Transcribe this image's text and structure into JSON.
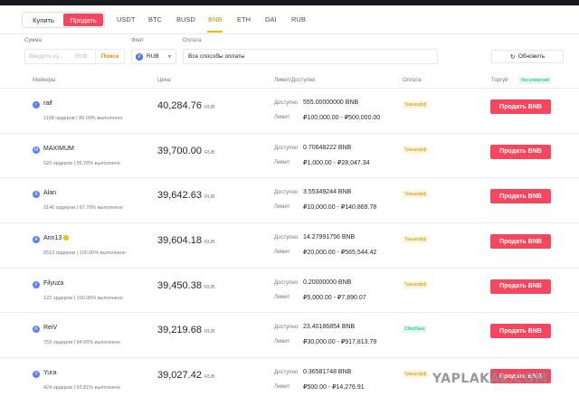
{
  "trade_toggle": {
    "buy": "Купить",
    "sell": "Продать"
  },
  "assets": [
    "USDT",
    "BTC",
    "BUSD",
    "BNB",
    "ETH",
    "DAI",
    "RUB"
  ],
  "active_asset": "BNB",
  "filters": {
    "amount_label": "Сумма",
    "amount_placeholder": "Введите су...",
    "amount_currency": "RUB",
    "search_label": "Поиск",
    "fiat_label": "Фиат",
    "fiat_value": "RUB",
    "payment_label": "Оплата",
    "payment_value": "Все способы оплаты",
    "refresh_label": "Обновить"
  },
  "table_headers": {
    "makers": "Мейкеры",
    "price": "Цена",
    "limit": "Лимит/Доступно",
    "payment": "Оплата",
    "trade": "Торгуй",
    "no_fee": "без комиссий"
  },
  "labels": {
    "available": "Доступно",
    "limit": "Лимит",
    "sell_button": "Продать BNB",
    "price_currency": "RUB"
  },
  "offers": [
    {
      "initial": "r",
      "name": "raif",
      "verified": false,
      "stats": "1108 ордеров | 86.09% выполнено",
      "price": "40,284.76",
      "available": "555.00000000 BNB",
      "limit": "₽100,000.00 - ₽500,000.00",
      "payment": "Тинькофф",
      "payment_type": "tinkoff"
    },
    {
      "initial": "M",
      "name": "MAXIMUM",
      "verified": false,
      "stats": "520 ордеров | 95.76% выполнено",
      "price": "39,700.00",
      "available": "0.70648222 BNB",
      "limit": "₽1,000.00 - ₽28,047.34",
      "payment": "Тинькофф",
      "payment_type": "tinkoff"
    },
    {
      "initial": "A",
      "name": "Alan",
      "verified": false,
      "stats": "3146 ордеров | 97.70% выполнено",
      "price": "39,642.63",
      "available": "3.55349244 BNB",
      "limit": "₽10,000.00 - ₽140,869.78",
      "payment": "Тинькофф",
      "payment_type": "tinkoff"
    },
    {
      "initial": "A",
      "name": "Ann13",
      "verified": true,
      "stats": "6513 ордеров | 100.00% выполнено",
      "price": "39,604.18",
      "available": "14.27991756 BNB",
      "limit": "₽20,000.00 - ₽565,544.42",
      "payment": "Тинькофф",
      "payment_type": "tinkoff"
    },
    {
      "initial": "F",
      "name": "Filyuza",
      "verified": false,
      "stats": "122 ордеров | 100.00% выполнено",
      "price": "39,450.38",
      "available": "0.20000000 BNB",
      "limit": "₽5,000.00 - ₽7,890.07",
      "payment": "Тинькофф",
      "payment_type": "tinkoff"
    },
    {
      "initial": "R",
      "name": "ReiV",
      "verified": false,
      "stats": "759 ордеров | 94.66% выполнено",
      "price": "39,219.68",
      "available": "23.40186854 BNB",
      "limit": "₽30,000.00 - ₽917,813.79",
      "payment": "Сбербанк",
      "payment_type": "sber"
    },
    {
      "initial": "Y",
      "name": "Yura",
      "verified": false,
      "stats": "424 ордеров | 93.81% выполнено",
      "price": "39,027.42",
      "available": "0.36581748 BNB",
      "limit": "₽500.00 - ₽14,276.91",
      "payment": "Тинькофф",
      "payment_type": "tinkoff"
    }
  ],
  "watermark": "YAPLAKAL.COM",
  "colors": {
    "sell": "#f6465d",
    "accent": "#f0b90b",
    "positive": "#02c076"
  }
}
